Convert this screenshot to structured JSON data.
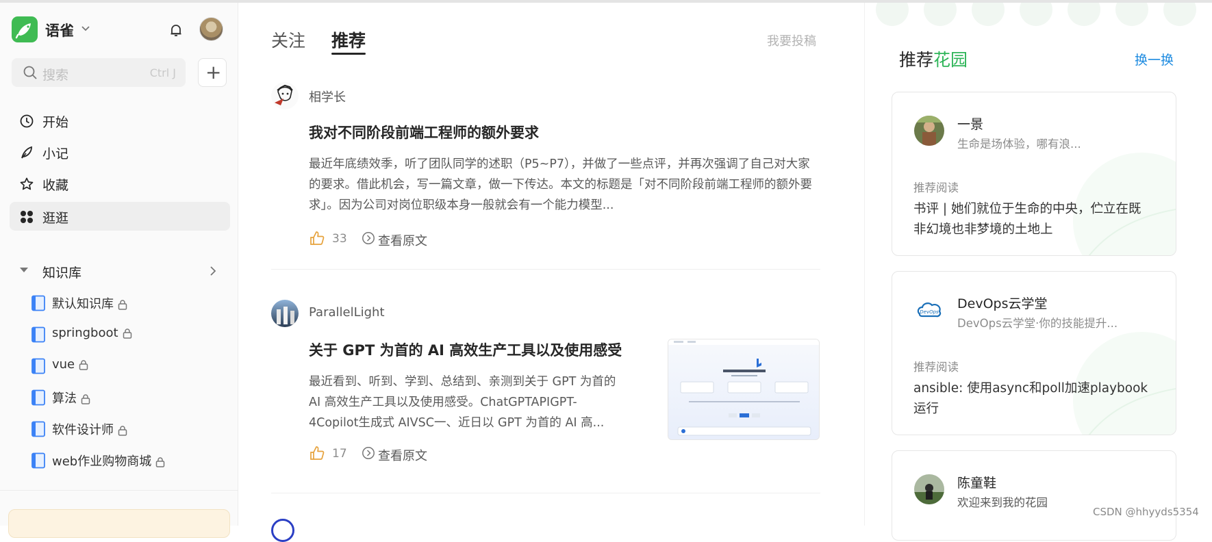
{
  "app": {
    "brand": "语雀",
    "search_placeholder": "搜索",
    "search_shortcut": "Ctrl J",
    "add_label": "+"
  },
  "nav": [
    {
      "label": "开始",
      "icon": "clock-icon"
    },
    {
      "label": "小记",
      "icon": "feather-icon"
    },
    {
      "label": "收藏",
      "icon": "star-icon"
    },
    {
      "label": "逛逛",
      "icon": "apps-icon",
      "active": true
    }
  ],
  "knowledge": {
    "title": "知识库",
    "items": [
      {
        "label": "默认知识库"
      },
      {
        "label": "springboot"
      },
      {
        "label": "vue"
      },
      {
        "label": "算法"
      },
      {
        "label": "软件设计师"
      },
      {
        "label": "web作业购物商城"
      }
    ]
  },
  "main": {
    "tabs": [
      {
        "label": "关注",
        "active": false
      },
      {
        "label": "推荐",
        "active": true
      }
    ],
    "submit_label": "我要投稿",
    "posts": [
      {
        "author": "相学长",
        "title": "我对不同阶段前端工程师的额外要求",
        "excerpt": "最近年底绩效季，听了团队同学的述职（P5~P7），并做了一些点评，并再次强调了自己对大家的要求。借此机会，写一篇文章，做一下传达。本文的标题是「对不同阶段前端工程师的额外要求」。因为公司对岗位职级本身一般就会有一个能力模型...",
        "likes": "33",
        "view_label": "查看原文"
      },
      {
        "author": "ParallelLight",
        "title": "关于 GPT 为首的 AI 高效生产工具以及使用感受",
        "excerpt": "最近看到、听到、学到、总结到、亲测到关于 GPT 为首的 AI 高效生产工具以及使用感受。ChatGPTAPIGPT-4Copilot生成式 AIVSC一、近日以 GPT 为首的 AI 高...",
        "likes": "17",
        "view_label": "查看原文"
      }
    ]
  },
  "right": {
    "title_prefix": "推荐",
    "title_accent": "花园",
    "accent_color": "#2fb559",
    "refresh_label": "换一换",
    "gardens": [
      {
        "name": "一景",
        "desc": "生命是场体验，哪有浪...",
        "reading_label": "推荐阅读",
        "reading_title": "书评 | 她们就位于生命的中央，伫立在既非幻境也非梦境的土地上"
      },
      {
        "name": "DevOps云学堂",
        "desc": "DevOps云学堂·你的技能提升...",
        "reading_label": "推荐阅读",
        "reading_title": "ansible: 使用async和poll加速playbook运行"
      },
      {
        "name": "陈童鞋",
        "desc": "欢迎来到我的花园"
      }
    ]
  },
  "watermark": "CSDN @hhyyds5354"
}
